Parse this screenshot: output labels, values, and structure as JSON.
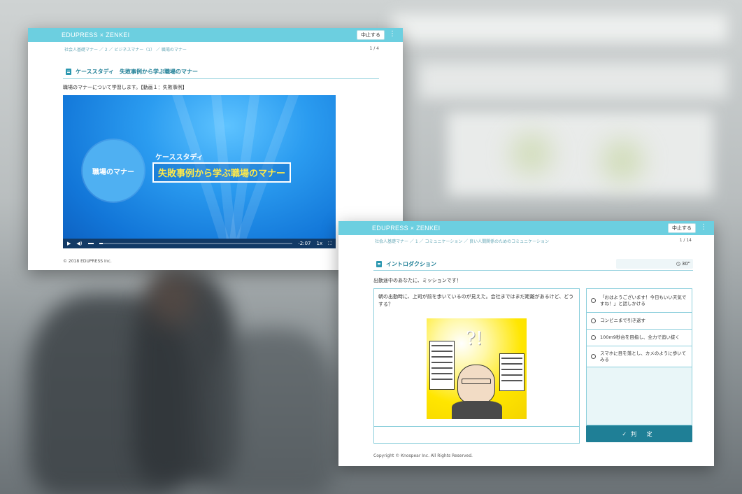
{
  "background": {
    "description_colors": [
      "#cfd3d3",
      "#8e9598"
    ]
  },
  "window1": {
    "brand": "EDUPRESS × ZENKEI",
    "stop_label": "中止する",
    "menu_icon": "kebab-icon",
    "breadcrumb": "社会人基礎マナー ／ 2 ／ ビジネスマナー（1） ／ 職場のマナー",
    "page_count": "1 / 4",
    "section_title": "ケーススタディ　失敗事例から学ぶ職場のマナー",
    "description": "職場のマナーについて学習します。【動画１：失敗事例】",
    "video": {
      "badge_text": "職場のマナー",
      "case_label": "ケーススタディ",
      "title": "失敗事例から学ぶ職場のマナー",
      "time": "-2:07",
      "speed": "1x",
      "progress": 0.02
    },
    "copyright": "© 2018 EDUPRESS Inc."
  },
  "window2": {
    "brand": "EDUPRESS × ZENKEI",
    "stop_label": "中止する",
    "menu_icon": "kebab-icon",
    "breadcrumb": "社会人基礎マナー ／ 1 ／ コミュニケーション ／ 良い人間関係のためのコミュニケーション",
    "page_count": "1 / 14",
    "section_title": "イントロダクション",
    "timer": "30\"",
    "mission": "出勤途中のあなたに、ミッションです！",
    "question": "朝の出勤時に、上司が前を歩いているのが見えた。会社まではまだ距離があるけど、どうする？",
    "options": [
      "「おはようございます！今日もいい天気ですね！」と話しかける",
      "コンビニまで引き返す",
      "100m9秒台を目指し、全力で追い抜く",
      "スマホに目を落とし、カメのように歩いてみる"
    ],
    "judge_label": "判 定",
    "copyright": "Copyright © Knospear Inc. All Rights Reserved."
  }
}
